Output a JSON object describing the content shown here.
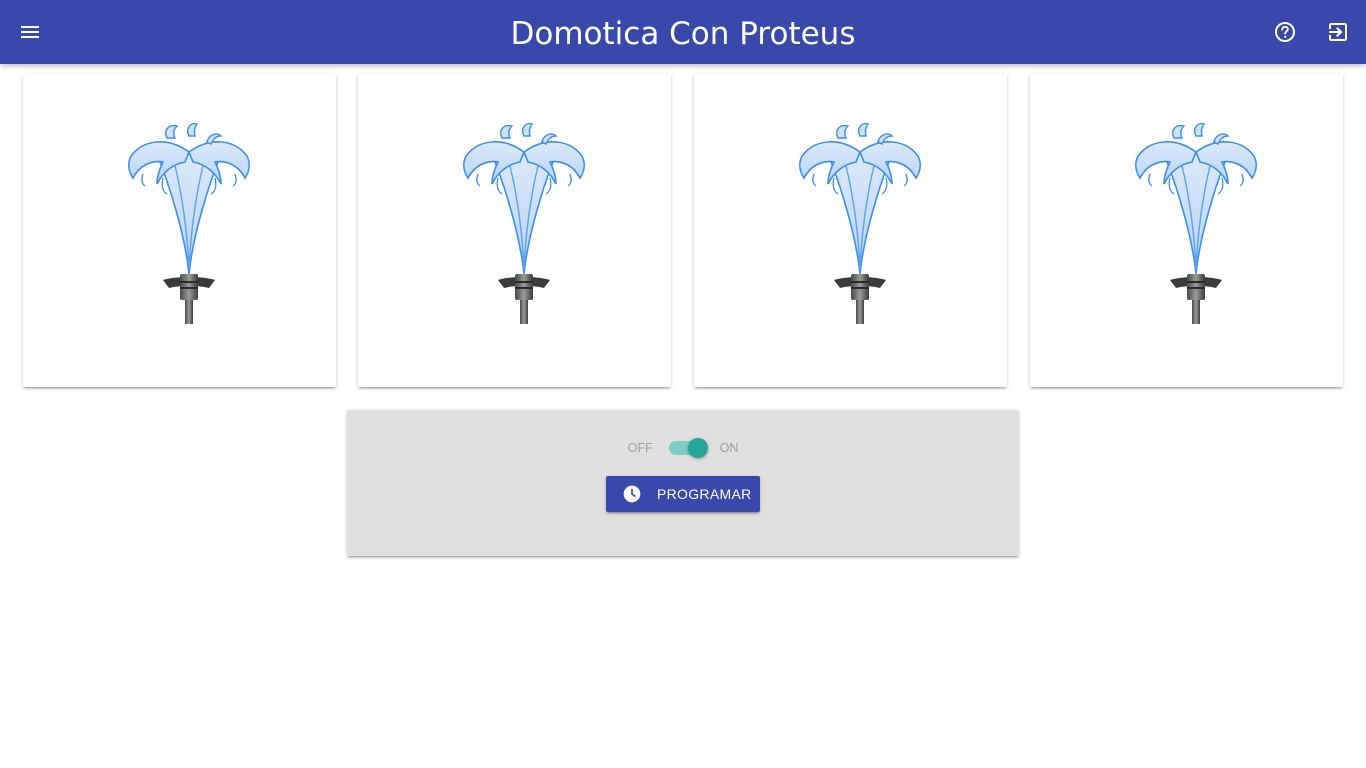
{
  "app": {
    "title": "Domotica Con Proteus"
  },
  "navbar": {
    "menu_icon": "menu-icon",
    "help_icon": "help-circle-icon",
    "logout_icon": "exit-to-app-icon",
    "background": "#3949ab"
  },
  "cards": [
    {
      "image": "fountain-sprinkler-image"
    },
    {
      "image": "fountain-sprinkler-image"
    },
    {
      "image": "fountain-sprinkler-image"
    },
    {
      "image": "fountain-sprinkler-image"
    }
  ],
  "control_panel": {
    "switch": {
      "off_label": "OFF",
      "on_label": "ON",
      "state": "on",
      "accent": "#26a69a"
    },
    "program_button": {
      "label": "PROGRAMAR",
      "icon": "clock-icon"
    }
  }
}
